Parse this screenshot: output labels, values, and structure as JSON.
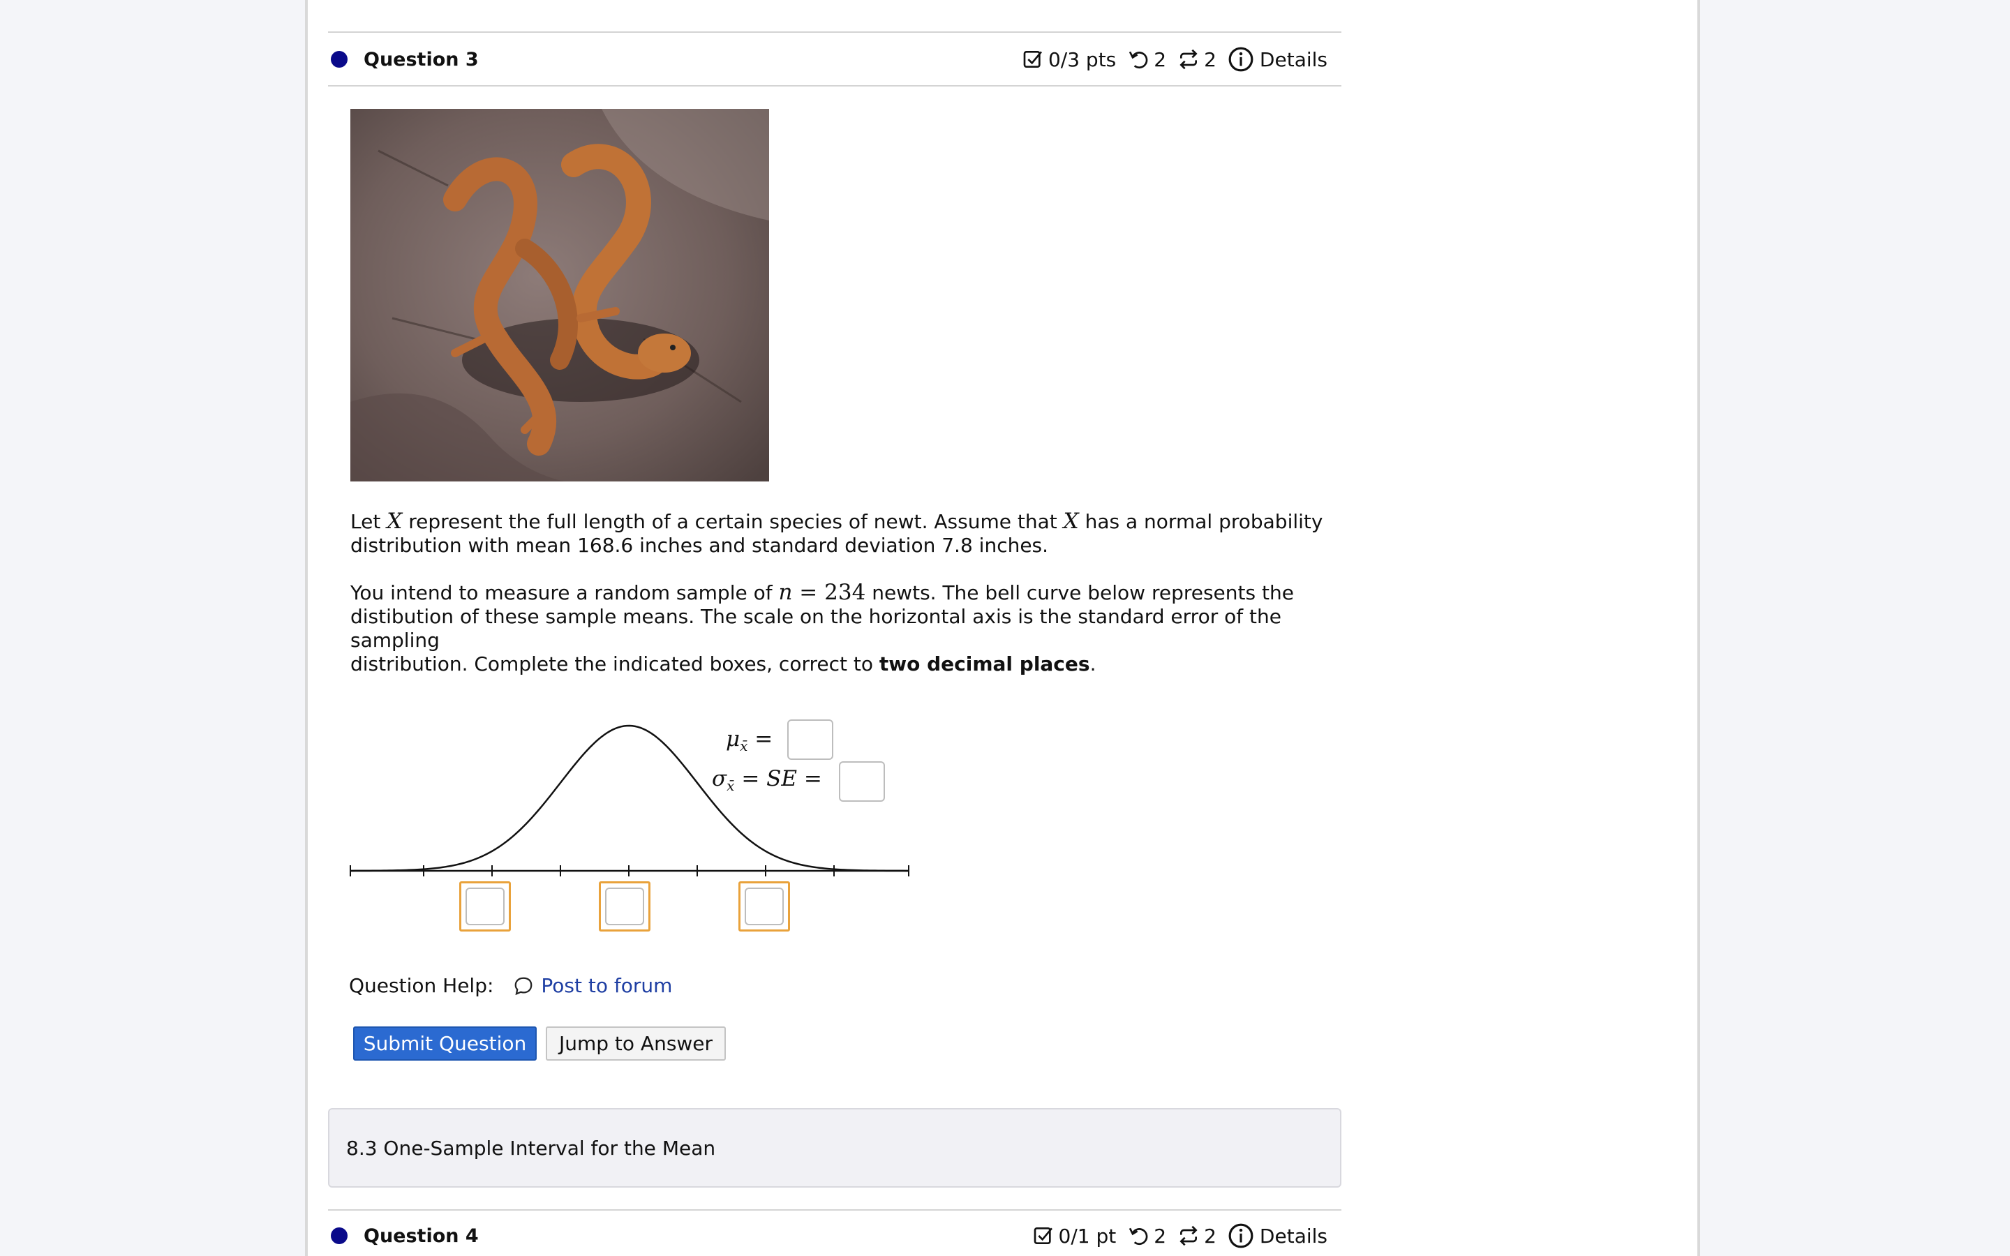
{
  "question3": {
    "title": "Question 3",
    "score": "0/3 pts",
    "retries": "2",
    "attempts": "2",
    "details_label": "Details",
    "prompt": {
      "p1_a": "Let ",
      "var_x": "X",
      "p1_b": " represent the full length of a certain species of newt. Assume that ",
      "p1_c": " has a normal probability",
      "p1_line2": "distribution with mean 168.6 inches and standard deviation 7.8 inches.",
      "p2_a": "You intend to measure a random sample of ",
      "var_n": "n",
      "eq": " = ",
      "n_value": "234",
      "p2_b": " newts. The bell curve below represents the",
      "p2_line2": "distibution of these sample means. The scale on the horizontal axis is the standard error of the sampling",
      "p2_line3_a": "distribution. Complete the indicated boxes, correct to ",
      "p2_line3_bold": "two decimal places",
      "p2_line3_end": "."
    },
    "graph": {
      "mu_symbol": "μ",
      "sigma_symbol": "σ",
      "sub_xbar": "x̄",
      "equals": "=",
      "se_label": "SE"
    },
    "help_label": "Question Help:",
    "forum_label": "Post to forum",
    "submit_label": "Submit Question",
    "jump_label": "Jump to Answer"
  },
  "section_title": "8.3 One-Sample Interval for the Mean",
  "question4": {
    "title": "Question 4",
    "score": "0/1 pt",
    "retries": "2",
    "attempts": "2",
    "details_label": "Details"
  },
  "colors": {
    "accent": "#2b6ad1",
    "dot": "#0a0a8a",
    "highlight_box": "#e9a23b",
    "link": "#1f3fa3"
  }
}
